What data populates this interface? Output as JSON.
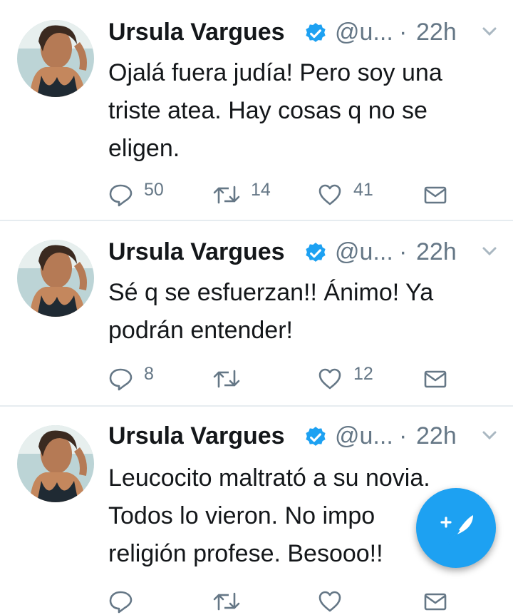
{
  "tweets": [
    {
      "name": "Ursula Vargues",
      "handle": "@u...",
      "dot": "·",
      "time": "22h",
      "lines": [
        "Ojalá fuera judía! Pero soy una",
        "triste atea. Hay cosas q no se",
        "eligen."
      ],
      "replies": "50",
      "retweets": "14",
      "likes": "41"
    },
    {
      "name": "Ursula Vargues",
      "handle": "@u...",
      "dot": "·",
      "time": "22h",
      "lines": [
        "Sé q se esfuerzan!! Ánimo! Ya",
        "podrán entender!"
      ],
      "replies": "8",
      "retweets": "",
      "likes": "12"
    },
    {
      "name": "Ursula Vargues",
      "handle": "@u...",
      "dot": "·",
      "time": "22h",
      "lines": [
        "Leucocito maltrató a su novia.",
        "Todos lo vieron. No impo",
        "religión profese. Besooo!!"
      ],
      "replies": "",
      "retweets": "",
      "likes": ""
    }
  ],
  "colors": {
    "accent": "#1da1f2",
    "text": "#14171a",
    "muted": "#657786",
    "separator": "#e6ecf0"
  },
  "icons": {
    "verified": "verified-badge-icon",
    "chevron": "chevron-down-icon",
    "reply": "reply-icon",
    "retweet": "retweet-icon",
    "like": "heart-icon",
    "dm": "envelope-icon",
    "compose": "compose-quill-icon"
  }
}
